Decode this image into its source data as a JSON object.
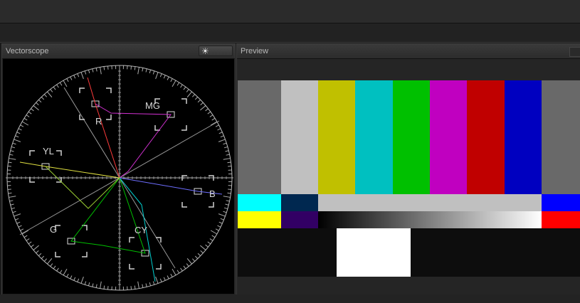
{
  "vectorscope": {
    "title": "Vectorscope",
    "brightness_icon": "sun-icon",
    "brightness_glyph": "☀",
    "labels": {
      "r": "R",
      "mg": "MG",
      "b": "B",
      "cy": "CY",
      "g": "G",
      "yl": "YL"
    }
  },
  "preview": {
    "title": "Preview",
    "top_bars": [
      "#696969",
      "#c0c0c0",
      "#c0c000",
      "#00c0c0",
      "#00c000",
      "#c000c0",
      "#c00000",
      "#0000c0",
      "#696969"
    ],
    "mid_row": [
      "#00ffff",
      "#002850",
      "#c0c0c0",
      "#0000ff"
    ],
    "ramp_row_ends": [
      "#ffff00",
      "#320064",
      "#ff0000"
    ],
    "bottom_row": [
      "#0d0d0d",
      "#ffffff",
      "#0d0d0d"
    ]
  }
}
